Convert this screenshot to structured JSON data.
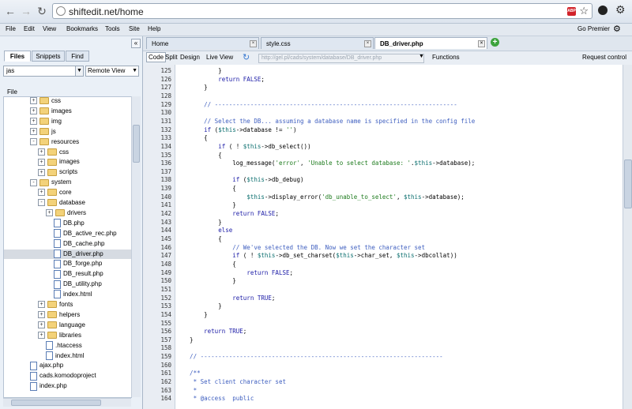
{
  "browser": {
    "url": "shiftedit.net/home",
    "abp": "ABP"
  },
  "menu": {
    "items": [
      "File",
      "Edit",
      "View",
      "Bookmarks",
      "Tools",
      "Site",
      "Help"
    ],
    "go_premier": "Go Premier"
  },
  "sidebar": {
    "tabs": [
      "Files",
      "Snippets",
      "Find"
    ],
    "filter_value": "jas",
    "site_select": "Remote View",
    "file_label": "File",
    "collapse": "«"
  },
  "tree": [
    {
      "label": "css",
      "type": "folder",
      "depth": 2,
      "exp": "+"
    },
    {
      "label": "images",
      "type": "folder",
      "depth": 2,
      "exp": "+"
    },
    {
      "label": "img",
      "type": "folder",
      "depth": 2,
      "exp": "+"
    },
    {
      "label": "js",
      "type": "folder",
      "depth": 2,
      "exp": "+"
    },
    {
      "label": "resources",
      "type": "folder",
      "depth": 2,
      "exp": "-"
    },
    {
      "label": "css",
      "type": "folder",
      "depth": 3,
      "exp": "+"
    },
    {
      "label": "images",
      "type": "folder",
      "depth": 3,
      "exp": "+"
    },
    {
      "label": "scripts",
      "type": "folder",
      "depth": 3,
      "exp": "+"
    },
    {
      "label": "system",
      "type": "folder",
      "depth": 2,
      "exp": "-"
    },
    {
      "label": "core",
      "type": "folder",
      "depth": 3,
      "exp": "+"
    },
    {
      "label": "database",
      "type": "folder",
      "depth": 3,
      "exp": "-"
    },
    {
      "label": "drivers",
      "type": "folder",
      "depth": 4,
      "exp": "+"
    },
    {
      "label": "DB.php",
      "type": "file",
      "depth": 5
    },
    {
      "label": "DB_active_rec.php",
      "type": "file",
      "depth": 5
    },
    {
      "label": "DB_cache.php",
      "type": "file",
      "depth": 5
    },
    {
      "label": "DB_driver.php",
      "type": "file",
      "depth": 5,
      "selected": true
    },
    {
      "label": "DB_forge.php",
      "type": "file",
      "depth": 5
    },
    {
      "label": "DB_result.php",
      "type": "file",
      "depth": 5
    },
    {
      "label": "DB_utility.php",
      "type": "file",
      "depth": 5
    },
    {
      "label": "index.html",
      "type": "file",
      "depth": 5
    },
    {
      "label": "fonts",
      "type": "folder",
      "depth": 3,
      "exp": "+"
    },
    {
      "label": "helpers",
      "type": "folder",
      "depth": 3,
      "exp": "+"
    },
    {
      "label": "language",
      "type": "folder",
      "depth": 3,
      "exp": "+"
    },
    {
      "label": "libraries",
      "type": "folder",
      "depth": 3,
      "exp": "+"
    },
    {
      "label": ".htaccess",
      "type": "file",
      "depth": 4
    },
    {
      "label": "index.html",
      "type": "file",
      "depth": 4
    },
    {
      "label": "ajax.php",
      "type": "file",
      "depth": 2
    },
    {
      "label": "cads.komodoproject",
      "type": "file",
      "depth": 2
    },
    {
      "label": "index.php",
      "type": "file",
      "depth": 2
    }
  ],
  "editor": {
    "tabs": [
      {
        "label": "Home"
      },
      {
        "label": "style.css"
      },
      {
        "label": "DB_driver.php",
        "active": true
      }
    ],
    "add_tab": "+",
    "views": [
      "Code",
      "Split",
      "Design",
      "Live View"
    ],
    "path": "http://gel.pl/cads/system/database/DB_driver.php",
    "functions": "Functions",
    "request_control": "Request control"
  },
  "code": [
    {
      "n": "125",
      "t": "            }"
    },
    {
      "n": "126",
      "t": "            return FALSE;"
    },
    {
      "n": "127",
      "t": "        }"
    },
    {
      "n": "128",
      "t": ""
    },
    {
      "n": "129",
      "t": "        // --------------------------------------------------------------------"
    },
    {
      "n": "130",
      "t": ""
    },
    {
      "n": "131",
      "t": "        // Select the DB... assuming a database name is specified in the config file"
    },
    {
      "n": "132",
      "t": "        if ($this->database != '')"
    },
    {
      "n": "133",
      "t": "        {"
    },
    {
      "n": "134",
      "t": "            if ( ! $this->db_select())"
    },
    {
      "n": "135",
      "t": "            {"
    },
    {
      "n": "136",
      "t": "                log_message('error', 'Unable to select database: '.$this->database);"
    },
    {
      "n": "137",
      "t": ""
    },
    {
      "n": "138",
      "t": "                if ($this->db_debug)"
    },
    {
      "n": "139",
      "t": "                {"
    },
    {
      "n": "140",
      "t": "                    $this->display_error('db_unable_to_select', $this->database);"
    },
    {
      "n": "141",
      "t": "                }"
    },
    {
      "n": "142",
      "t": "                return FALSE;"
    },
    {
      "n": "143",
      "t": "            }"
    },
    {
      "n": "144",
      "t": "            else"
    },
    {
      "n": "145",
      "t": "            {"
    },
    {
      "n": "146",
      "t": "                // We've selected the DB. Now we set the character set"
    },
    {
      "n": "147",
      "t": "                if ( ! $this->db_set_charset($this->char_set, $this->dbcollat))"
    },
    {
      "n": "148",
      "t": "                {"
    },
    {
      "n": "149",
      "t": "                    return FALSE;"
    },
    {
      "n": "150",
      "t": "                }"
    },
    {
      "n": "151",
      "t": ""
    },
    {
      "n": "152",
      "t": "                return TRUE;"
    },
    {
      "n": "153",
      "t": "            }"
    },
    {
      "n": "154",
      "t": "        }"
    },
    {
      "n": "155",
      "t": ""
    },
    {
      "n": "156",
      "t": "        return TRUE;"
    },
    {
      "n": "157",
      "t": "    }"
    },
    {
      "n": "158",
      "t": ""
    },
    {
      "n": "159",
      "t": "    // --------------------------------------------------------------------"
    },
    {
      "n": "160",
      "t": ""
    },
    {
      "n": "161",
      "t": "    /**"
    },
    {
      "n": "162",
      "t": "     * Set client character set"
    },
    {
      "n": "163",
      "t": "     *"
    },
    {
      "n": "164",
      "t": "     * @access  public"
    }
  ]
}
